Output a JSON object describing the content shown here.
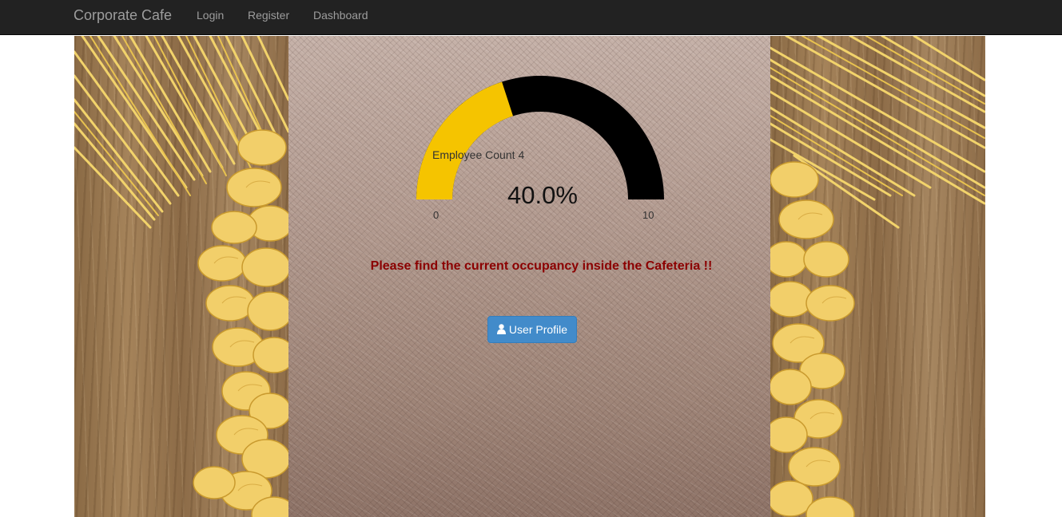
{
  "navbar": {
    "brand": "Corporate Cafe",
    "links": [
      "Login",
      "Register",
      "Dashboard"
    ]
  },
  "gauge": {
    "title": "Employee Count",
    "count": "4",
    "value_text": "40.0%",
    "fraction": 0.4,
    "min": "0",
    "max": "10",
    "fill_color": "#f5c400",
    "track_color": "#000000"
  },
  "message": "Please find the current occupancy inside the Cafeteria !!",
  "button": {
    "label": "User Profile",
    "icon": "user-icon",
    "color": "#428bca"
  },
  "background": {
    "side_image": "pasta-on-wood",
    "center_image": "brushed-metal"
  }
}
